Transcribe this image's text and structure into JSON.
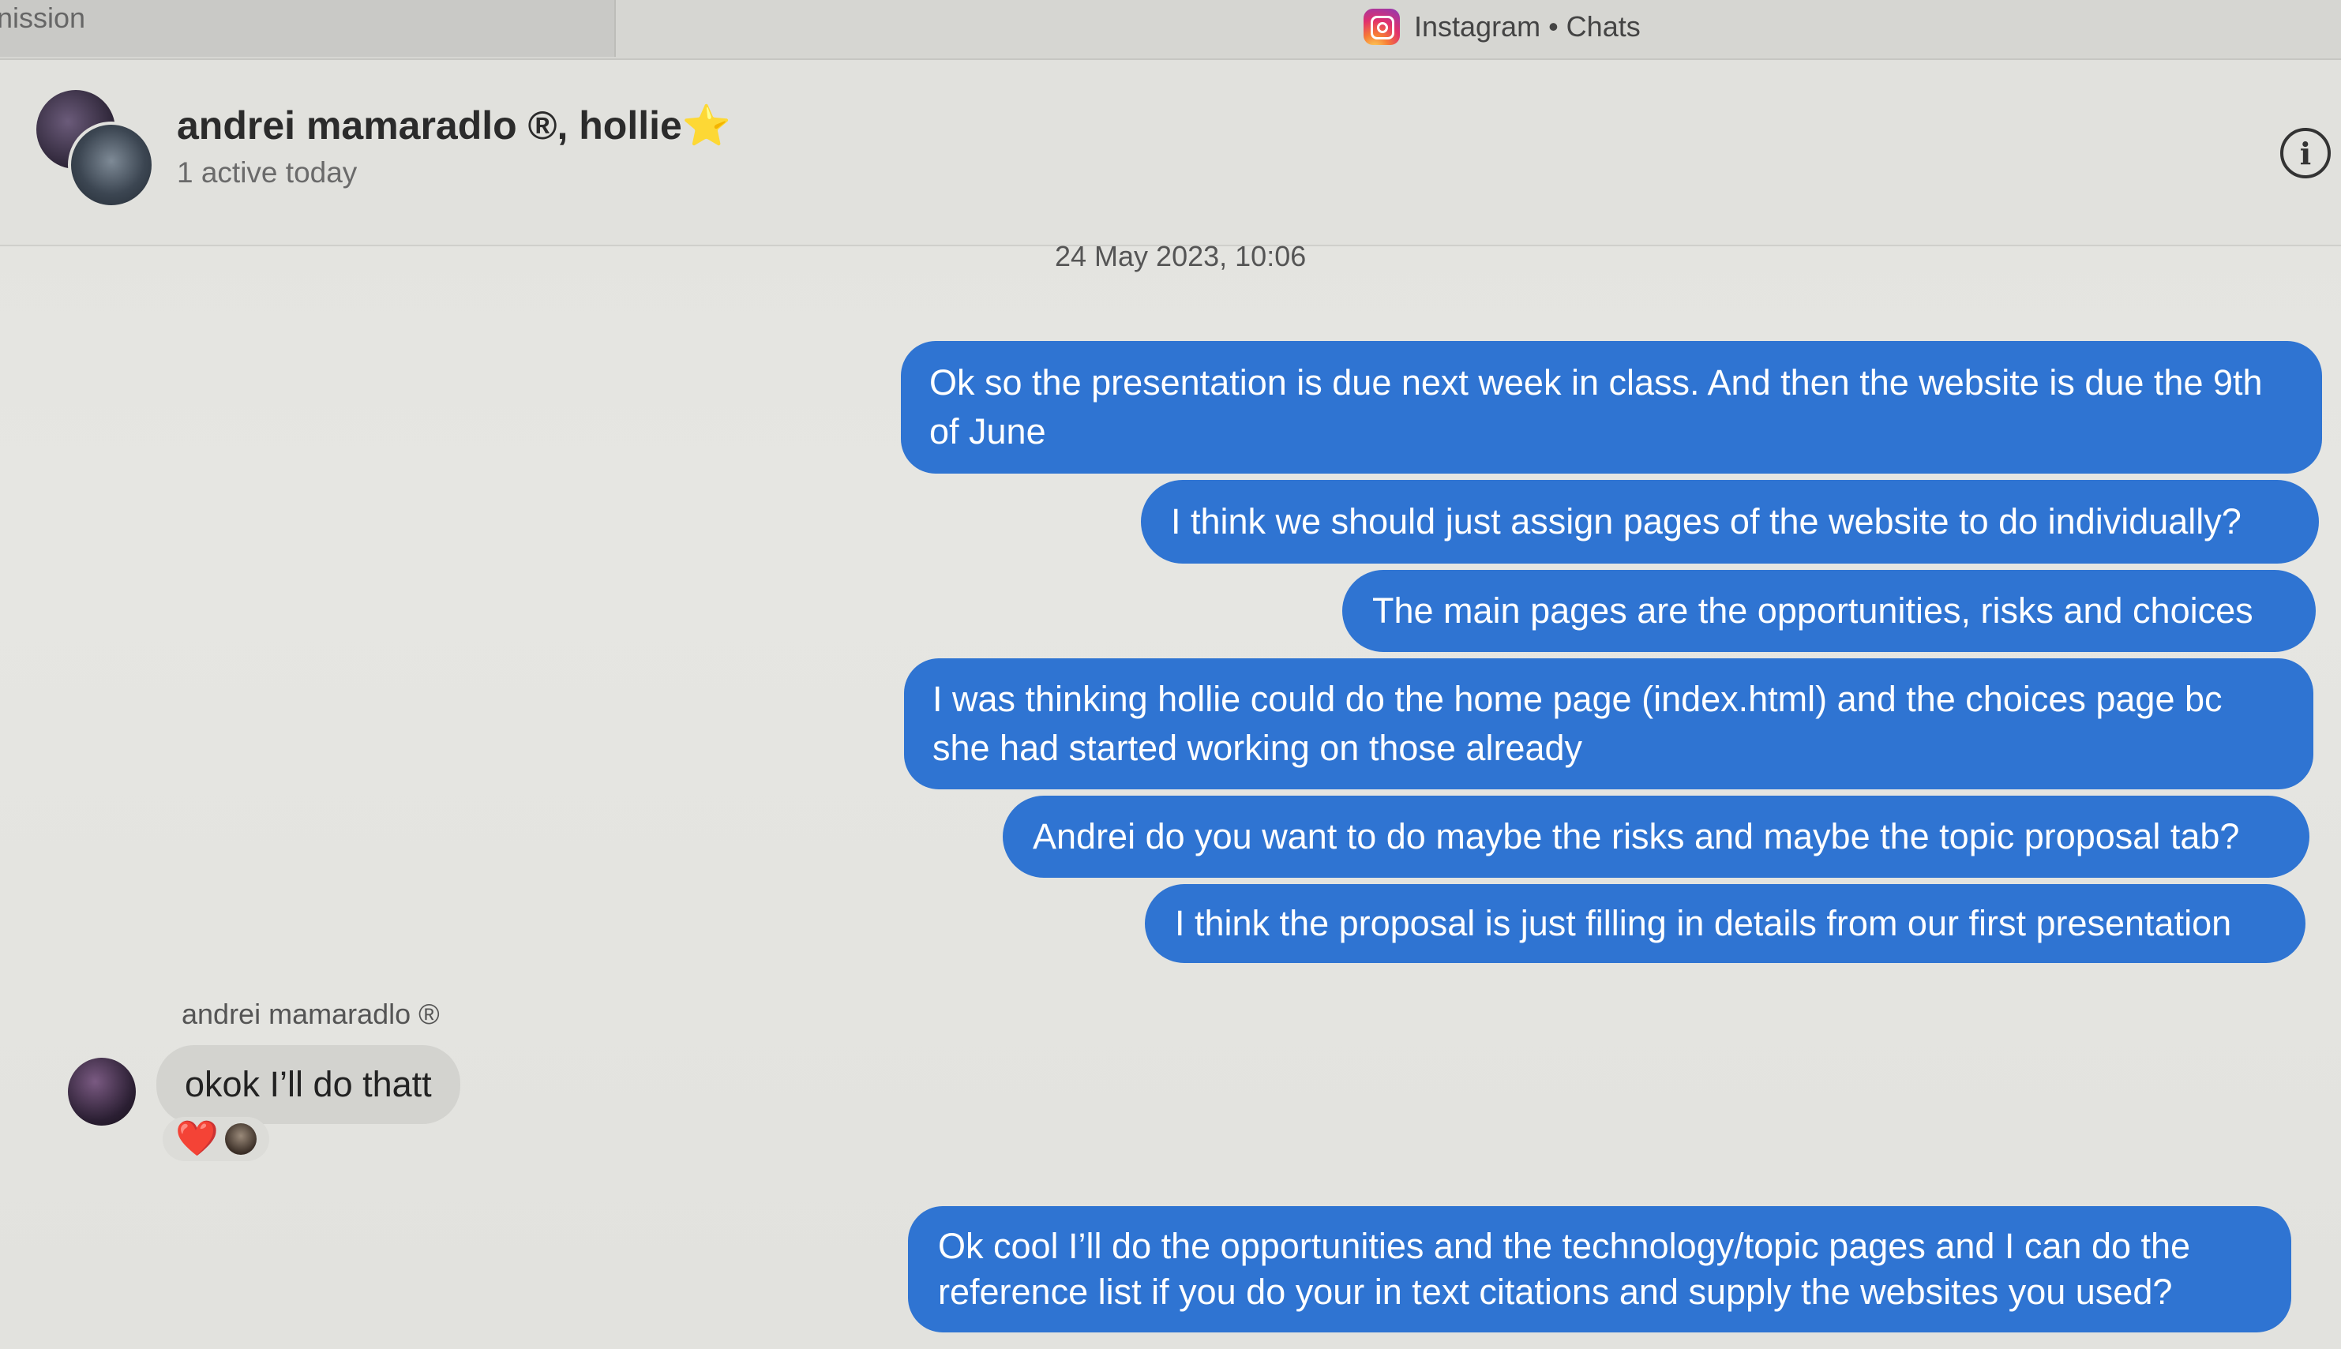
{
  "tabs": {
    "left_tab_label": "nission",
    "active_tab_title": "Instagram • Chats",
    "active_tab_icon": "instagram-icon"
  },
  "conversation": {
    "title": "andrei mamaradlo ®, hollie⭐",
    "subtitle": "1 active today",
    "info_icon": "info-icon"
  },
  "messages": {
    "timestamp": "24 May 2023, 10:06",
    "outgoing": [
      {
        "text": "Ok so the presentation is due next week in class. And then the website is due the 9th of June"
      },
      {
        "text": "I think we should just assign pages of the website to do individually?"
      },
      {
        "text": "The main pages are the opportunities, risks and choices"
      },
      {
        "text": "I was thinking hollie could do the home page (index.html) and the choices page bc she had started working on those already"
      },
      {
        "text": "Andrei do you want to do maybe the risks and maybe the topic proposal tab?"
      },
      {
        "text": "I think the proposal is just filling in details from our first presentation"
      }
    ],
    "incoming": {
      "sender": "andrei mamaradlo ®",
      "text": "okok I’ll do thatt",
      "reaction": "❤️"
    },
    "last_outgoing": {
      "text": "Ok cool I’ll do the opportunities and the technology/topic pages and I can do the reference list if you do your in text citations and supply the websites you used?"
    }
  },
  "colors": {
    "outgoing_bubble": "#2f74d2",
    "incoming_bubble": "#d3d3cf",
    "background": "#e3e3df"
  }
}
